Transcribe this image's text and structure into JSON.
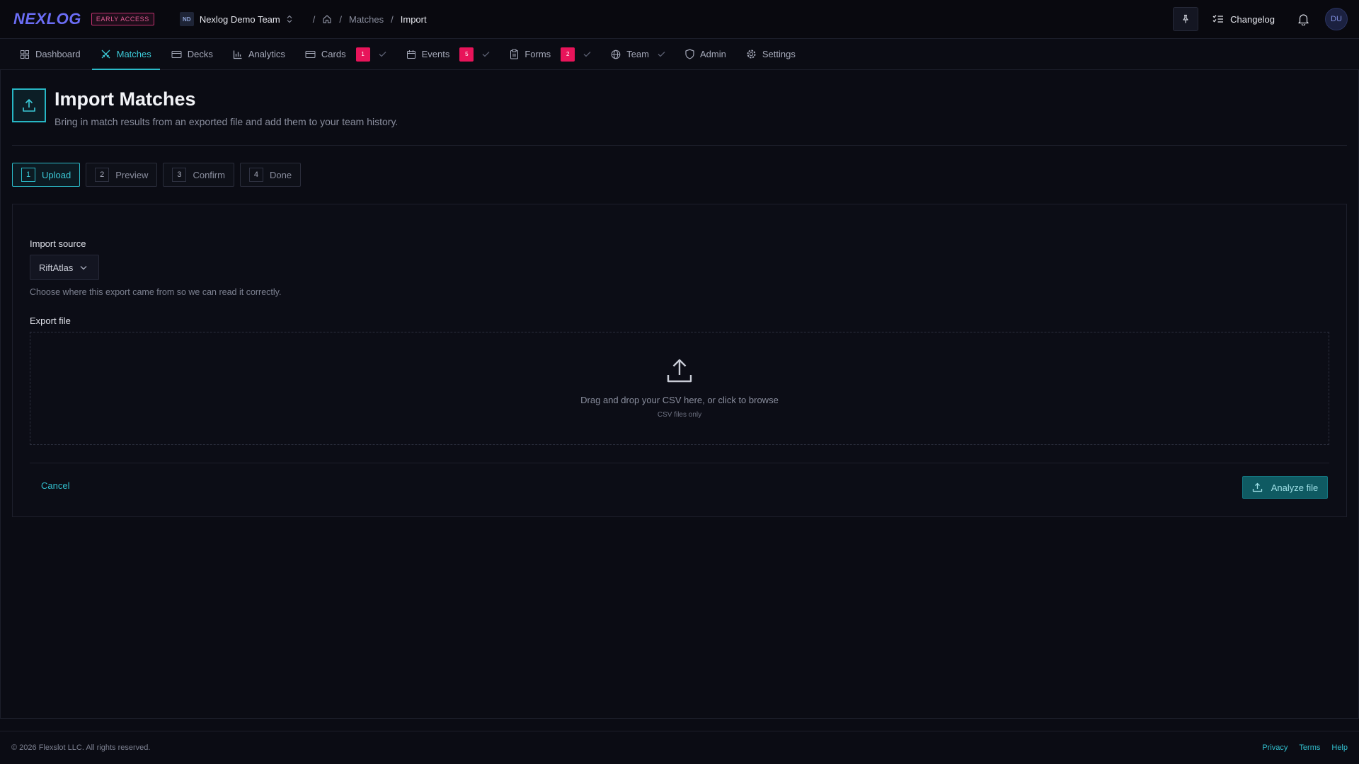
{
  "brand": {
    "logo": "NEXLOG",
    "badge": "EARLY ACCESS",
    "accent": "#2bbac8",
    "alert": "#e8145a"
  },
  "team": {
    "initials": "ND",
    "name": "Nexlog Demo Team"
  },
  "breadcrumb": {
    "home_icon": "home-icon",
    "items": [
      "Matches",
      "Import"
    ]
  },
  "header_actions": {
    "pin_icon": "pin-icon",
    "changelog_label": "Changelog",
    "bell_icon": "bell-icon",
    "user_initials": "DU"
  },
  "nav": {
    "items": [
      {
        "label": "Dashboard",
        "icon": "dashboard-icon"
      },
      {
        "label": "Matches",
        "icon": "swords-icon",
        "active": true
      },
      {
        "label": "Decks",
        "icon": "card-icon"
      },
      {
        "label": "Analytics",
        "icon": "bar-chart-icon"
      },
      {
        "label": "Cards",
        "icon": "card-icon",
        "count": "1",
        "check": true
      },
      {
        "label": "Events",
        "icon": "calendar-icon",
        "count": "5",
        "check": true
      },
      {
        "label": "Forms",
        "icon": "clipboard-icon",
        "count": "2",
        "check": true
      },
      {
        "label": "Team",
        "icon": "globe-icon",
        "check": true
      },
      {
        "label": "Admin",
        "icon": "shield-icon"
      },
      {
        "label": "Settings",
        "icon": "gear-icon"
      }
    ]
  },
  "page": {
    "title": "Import Matches",
    "subtitle": "Bring in match results from an exported file and add them to your team history."
  },
  "steps": [
    {
      "num": "1",
      "label": "Upload",
      "active": true
    },
    {
      "num": "2",
      "label": "Preview"
    },
    {
      "num": "3",
      "label": "Confirm"
    },
    {
      "num": "4",
      "label": "Done"
    }
  ],
  "form": {
    "source_label": "Import source",
    "source_value": "RiftAtlas",
    "source_help": "Choose where this export came from so we can read it correctly.",
    "file_label": "Export file",
    "drop_text": "Drag and drop your CSV here, or click to browse",
    "drop_sub": "CSV files only",
    "cancel_label": "Cancel",
    "analyze_label": "Analyze file"
  },
  "footer": {
    "copyright": "© 2026 Flexslot LLC. All rights reserved.",
    "links": [
      "Privacy",
      "Terms",
      "Help"
    ]
  }
}
